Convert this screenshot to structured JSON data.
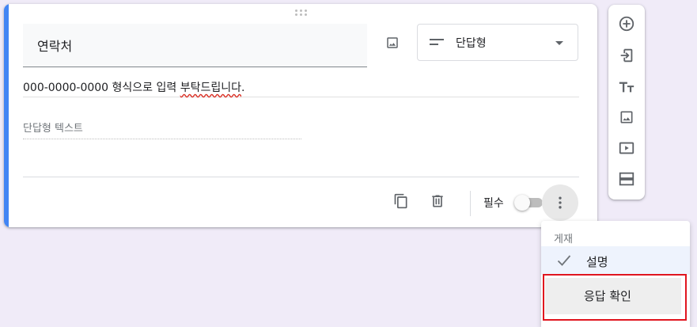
{
  "question": {
    "title": "연락처",
    "type_label": "단답형",
    "description": "000-0000-0000 형식으로 입력 ",
    "description_spell": "부탁드립니다",
    "description_end": ".",
    "answer_placeholder": "단답형 텍스트",
    "required_label": "필수",
    "required_on": false
  },
  "menu": {
    "header": "게재",
    "items": [
      {
        "label": "설명",
        "checked": true
      },
      {
        "label": "응답 확인",
        "checked": false
      }
    ]
  },
  "colors": {
    "background": "#f0ebf8",
    "accent": "#4285f4",
    "highlight": "#e0151f"
  },
  "icons": {
    "card": [
      "drag-handle-icon",
      "image-icon",
      "short-answer-icon",
      "dropdown-arrow-icon",
      "copy-icon",
      "delete-icon",
      "more-vert-icon"
    ],
    "side_toolbar": [
      "add-circle-icon",
      "import-icon",
      "title-icon",
      "image-icon",
      "video-icon",
      "section-icon"
    ]
  }
}
